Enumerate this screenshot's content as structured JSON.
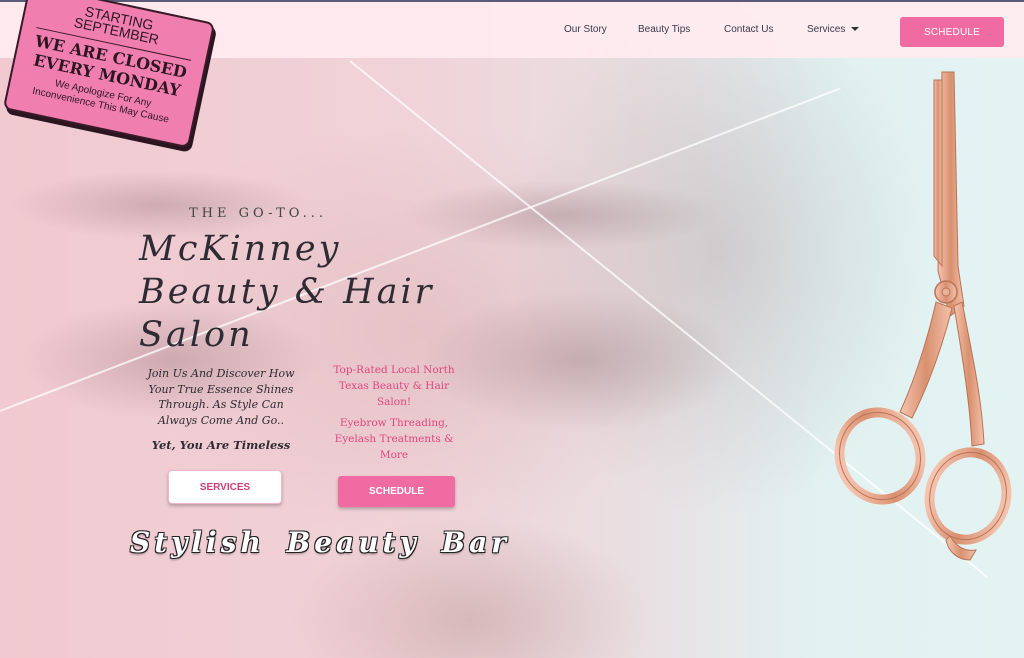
{
  "nav": {
    "links": [
      "Our Story",
      "Beauty Tips",
      "Contact Us",
      "Services"
    ],
    "schedule_label": "SCHEDULE"
  },
  "notice": {
    "line1": "STARTING",
    "line2": "SEPTEMBER",
    "line3": "WE ARE CLOSED",
    "line4": "EVERY MONDAY",
    "line5": "We Apologize For Any",
    "line6": "Inconvenience This May Cause"
  },
  "hero": {
    "kicker": "THE GO-TO...",
    "title": "McKinney Beauty & Hair Salon",
    "description": "Join Us And Discover How Your True Essence Shines Through. As Style Can Always Come And Go..",
    "tagline": "Yet, You Are Timeless",
    "pink_text_1": "Top-Rated Local North Texas Beauty & Hair Salon!",
    "pink_text_2": "Eyebrow Threading, Eyelash Treatments & More",
    "services_button": "SERVICES",
    "schedule_button": "SCHEDULE",
    "subtitle": "Stylish Beauty Bar"
  },
  "colors": {
    "accent_pink": "#ef6ba2",
    "text_pink": "#e0457f",
    "notice_pink": "#f07fb0"
  },
  "icons": [
    "chevron-down-icon",
    "scissors-icon"
  ]
}
